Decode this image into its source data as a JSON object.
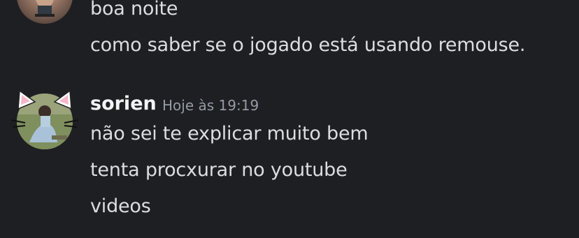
{
  "previous_group": {
    "messages": [
      "boa noite",
      "como saber se o jogado está usando remouse."
    ]
  },
  "current_group": {
    "username": "sorien",
    "timestamp": "Hoje às 19:19",
    "messages": [
      "não sei te explicar muito bem",
      "tenta procxurar no youtube",
      "videos"
    ]
  },
  "colors": {
    "background": "#1e1f22",
    "message_text": "#dbdee1",
    "username": "#f2f3f5",
    "timestamp": "#949ba4"
  },
  "icons": {
    "previous_avatar": "user-avatar-photo",
    "sorien_avatar": "user-avatar-cat-ears-decoration"
  }
}
